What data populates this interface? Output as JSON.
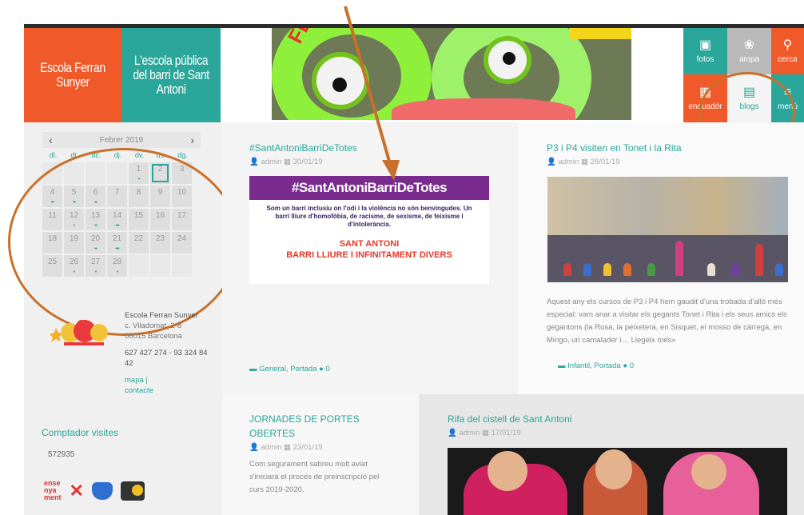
{
  "header": {
    "logo_red": "Escola Ferran Sunyer",
    "logo_teal": "L'escola pública del barri de Sant Antoni",
    "banner_word": "FERRAN",
    "tiles": [
      {
        "label": "fotos",
        "icon": "photo-icon",
        "color": "#2aa69a"
      },
      {
        "label": "ampa",
        "icon": "ampa-icon",
        "color": "#b9b9b9"
      },
      {
        "label": "cerca",
        "icon": "search-icon",
        "color": "#f05a2a"
      },
      {
        "label": "enquadór",
        "icon": "calendar-icon",
        "color": "#f05a2a"
      },
      {
        "label": "blogs",
        "icon": "bag-icon",
        "color": "#f4f4f4"
      },
      {
        "label": "menú",
        "icon": "menu-icon",
        "color": "#2aa69a"
      }
    ]
  },
  "calendar": {
    "month": "Febrer 2019",
    "prev": "‹",
    "next": "›",
    "dows": [
      "dl.",
      "dt.",
      "dc.",
      "dj.",
      "dv.",
      "ds.",
      "dg."
    ],
    "weeks": [
      [
        {
          "d": ""
        },
        {
          "d": ""
        },
        {
          "d": ""
        },
        {
          "d": ""
        },
        {
          "d": "1",
          "dots": "•"
        },
        {
          "d": "2",
          "today": true
        },
        {
          "d": "3"
        }
      ],
      [
        {
          "d": "4",
          "dots": "••"
        },
        {
          "d": "5",
          "dots": "••"
        },
        {
          "d": "6",
          "dots": "••"
        },
        {
          "d": "7"
        },
        {
          "d": "8"
        },
        {
          "d": "9"
        },
        {
          "d": "10"
        }
      ],
      [
        {
          "d": "11"
        },
        {
          "d": "12",
          "dots": "•"
        },
        {
          "d": "13",
          "dots": "••"
        },
        {
          "d": "14",
          "dots": "•••"
        },
        {
          "d": "15"
        },
        {
          "d": "16"
        },
        {
          "d": "17"
        }
      ],
      [
        {
          "d": "18"
        },
        {
          "d": "19"
        },
        {
          "d": "20",
          "dots": "••"
        },
        {
          "d": "21",
          "dots": "•••"
        },
        {
          "d": "22"
        },
        {
          "d": "23"
        },
        {
          "d": "24"
        }
      ],
      [
        {
          "d": "25"
        },
        {
          "d": "26",
          "dots": "•"
        },
        {
          "d": "27",
          "dots": "•"
        },
        {
          "d": "28",
          "dots": "•"
        },
        {
          "d": ""
        },
        {
          "d": ""
        },
        {
          "d": ""
        }
      ]
    ]
  },
  "school": {
    "name": "Escola Ferran Sunyer",
    "address1": "c. Viladomat, 2-8",
    "address2": "08015 Barcelona",
    "phones": "627 427 274 - 93 324 84 42",
    "link_map": "mapa",
    "sep": "|",
    "link_contact": "contacte"
  },
  "visits": {
    "title": "Comptador visites",
    "value": "572935"
  },
  "posts": [
    {
      "title": "#SantAntoniBarriDeTotes",
      "author": "admin",
      "date": "30/01/19",
      "categories": "General, Portada",
      "comments": "0",
      "promo_head": "#SantAntoniBarriDeTotes",
      "promo_body": "Som un barri inclusiu on l'odi i la violència no són benvingudes. Un barri lliure d'homofòbia, de racisme, de sexisme, de feixisme i d'intolerància.",
      "promo_foot1": "SANT ANTONI",
      "promo_foot2": "BARRI LLIURE I INFINITAMENT DIVERS"
    },
    {
      "title": "P3 i P4 visiten en Tonet i la Rita",
      "author": "admin",
      "date": "28/01/19",
      "excerpt": "Aquest any els cursos de P3 i P4 hem gaudit d'una trobada d'allò més especial: vam anar a visitar els gegants Tonet i Rita i els seus amics els gegantons (la Rosa, la peixetera, en Sisquet, el mosso de càrrega, en Mingo, un camalader i… Llegeix més»",
      "categories": "Infantil, Portada",
      "comments": "0"
    },
    {
      "title": "JORNADES DE PORTES OBERTES",
      "author": "admin",
      "date": "23/01/19",
      "excerpt": "Com segurament sabreu molt aviat s'iniciarà el procés de preinscripció pel curs 2019-2020."
    },
    {
      "title": "Rifa del cistell de Sant Antoni",
      "author": "admin",
      "date": "17/01/19"
    }
  ]
}
